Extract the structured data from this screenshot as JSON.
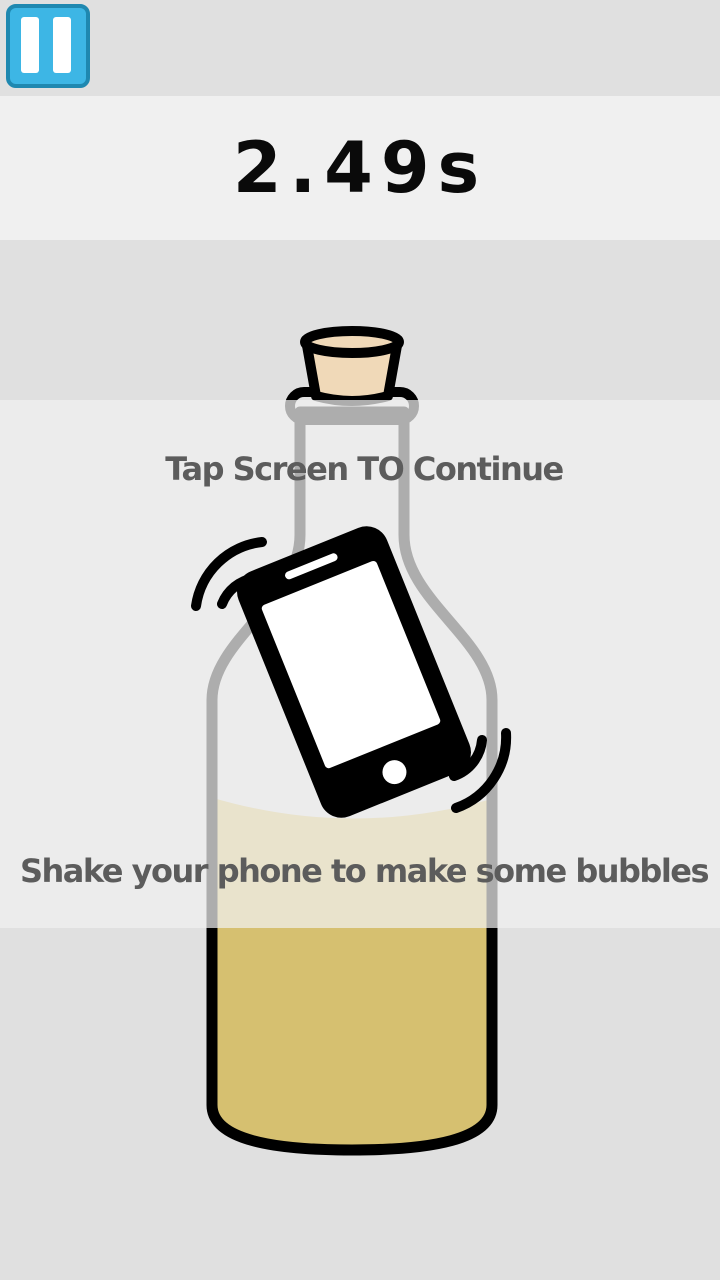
{
  "timer": {
    "value": "2.49s"
  },
  "pause_button": {
    "icon": "pause-icon",
    "color": "#3db6e5"
  },
  "overlay": {
    "tap_prompt": "Tap Screen TO Continue",
    "shake_prompt": "Shake your phone to make some bubbles"
  },
  "bottle": {
    "liquid_color": "#d6c070",
    "cork_color": "#f0d9b8",
    "outline_color": "#000000"
  },
  "hint_icon": "shaking-phone-icon"
}
